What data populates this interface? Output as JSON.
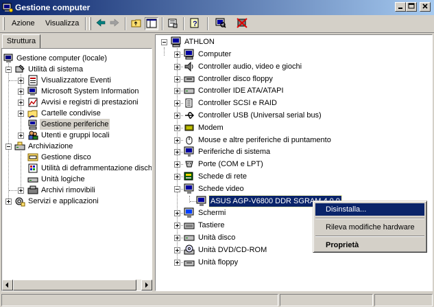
{
  "window": {
    "title": "Gestione computer",
    "controls": [
      "minimize",
      "maximize",
      "close"
    ]
  },
  "menu": {
    "items": [
      {
        "label": "Azione"
      },
      {
        "label": "Visualizza"
      }
    ]
  },
  "toolbar": {
    "buttons": [
      "back-icon",
      "forward-icon",
      "up-folder-icon",
      "show-tree-icon",
      "properties-icon",
      "help-icon",
      "scan-hardware-icon",
      "disable-device-icon"
    ]
  },
  "tab": {
    "label": "Struttura"
  },
  "left_tree": {
    "root": "Gestione computer (locale)",
    "nodes": [
      {
        "label": "Utilità di sistema"
      },
      {
        "label": "Visualizzatore Eventi"
      },
      {
        "label": "Microsoft System Information"
      },
      {
        "label": "Avvisi e registri di prestazioni"
      },
      {
        "label": "Cartelle condivise"
      },
      {
        "label": "Gestione periferiche"
      },
      {
        "label": "Utenti e gruppi locali"
      },
      {
        "label": "Archiviazione"
      },
      {
        "label": "Gestione disco"
      },
      {
        "label": "Utilità di deframmentazione dischi"
      },
      {
        "label": "Unità logiche"
      },
      {
        "label": "Archivi rimovibili"
      },
      {
        "label": "Servizi e applicazioni"
      }
    ]
  },
  "device_tree": {
    "root": "ATHLON",
    "categories": [
      {
        "label": "Computer"
      },
      {
        "label": "Controller audio, video e giochi"
      },
      {
        "label": "Controller disco floppy"
      },
      {
        "label": "Controller IDE ATA/ATAPI"
      },
      {
        "label": "Controller SCSI e RAID"
      },
      {
        "label": "Controller USB (Universal serial bus)"
      },
      {
        "label": "Modem"
      },
      {
        "label": "Mouse e altre periferiche di puntamento"
      },
      {
        "label": "Periferiche di sistema"
      },
      {
        "label": "Porte (COM e LPT)"
      },
      {
        "label": "Schede di rete"
      },
      {
        "label": "Schede video"
      },
      {
        "label": "ASUS AGP-V6800 DDR SGRAM 4.0.0"
      },
      {
        "label": "Schermi"
      },
      {
        "label": "Tastiere"
      },
      {
        "label": "Unità disco"
      },
      {
        "label": "Unità DVD/CD-ROM"
      },
      {
        "label": "Unità floppy"
      }
    ]
  },
  "context_menu": {
    "items": [
      {
        "label": "Disinstalla..."
      },
      {
        "label": "Rileva modifiche hardware"
      },
      {
        "label": "Proprietà"
      }
    ]
  },
  "colors": {
    "title_start": "#0a246a",
    "title_end": "#a6caf0",
    "selection": "#0a246a",
    "face": "#d4d0c8"
  }
}
